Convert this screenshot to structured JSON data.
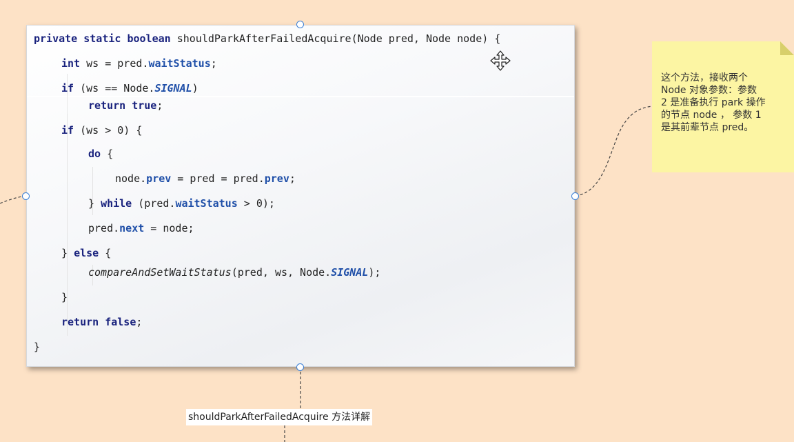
{
  "code": {
    "line1": {
      "kw": "private static boolean",
      "rest": " shouldParkAfterFailedAcquire(Node pred, Node node) {"
    },
    "line2": {
      "kw": "int",
      "a": " ws = pred.",
      "fld": "waitStatus",
      "b": ";"
    },
    "line3": {
      "kw": "if",
      "a": " (ws == Node.",
      "const": "SIGNAL",
      "b": ")"
    },
    "line4": {
      "kw": "return true",
      "b": ";"
    },
    "line5": {
      "kw": "if",
      "rest": " (ws > 0) {"
    },
    "line6": {
      "kw": "do",
      "rest": " {"
    },
    "line7": {
      "a": "node.",
      "fld1": "prev",
      "b": " = pred = pred.",
      "fld2": "prev",
      "c": ";"
    },
    "line8": {
      "a": "} ",
      "kw": "while",
      "b": " (pred.",
      "fld": "waitStatus",
      "c": " > 0);"
    },
    "line9": {
      "a": "pred.",
      "fld": "next",
      "b": " = node;"
    },
    "line10": {
      "a": "} ",
      "kw": "else",
      "b": " {"
    },
    "line11": {
      "it": "compareAndSetWaitStatus",
      "a": "(pred, ws, Node.",
      "const": "SIGNAL",
      "b": ");"
    },
    "line12": {
      "a": "}"
    },
    "line13": {
      "kw": "return false",
      "b": ";"
    },
    "line14": {
      "a": "}"
    }
  },
  "note": {
    "text": "这个方法，接收两个\nNode 对象参数：参数\n2 是准备执行 park 操作\n的节点 node ， 参数 1\n是其前辈节点 pred。"
  },
  "caption": {
    "text": "shouldParkAfterFailedAcquire 方法详解"
  },
  "colors": {
    "canvas": "#fde2c6",
    "keyword": "#1a237e",
    "field": "#1f4fa8",
    "note": "#fcf5a3",
    "handle": "#3a7fd6"
  },
  "icons": {
    "cursor": "move-cursor-icon",
    "handle": "selection-handle-icon"
  }
}
